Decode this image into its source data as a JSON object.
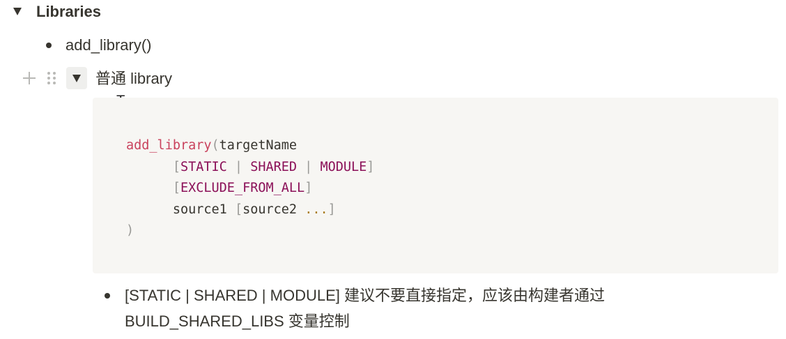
{
  "heading": {
    "title": "Libraries"
  },
  "bullets": [
    {
      "text": "add_library()"
    }
  ],
  "toggle_block": {
    "title": "普通 library",
    "code": {
      "fn": "add_library",
      "paren_open": "(",
      "arg": "targetName",
      "indent": "      ",
      "bracket_open": "[",
      "bracket_close": "]",
      "pipe": " | ",
      "kw_static": "STATIC",
      "kw_shared": "SHARED",
      "kw_module": "MODULE",
      "kw_exclude": "EXCLUDE_FROM_ALL",
      "source1": "source1 ",
      "source2": "source2 ",
      "ellipsis": "...",
      "paren_close": ")"
    }
  },
  "note": {
    "line1": "[STATIC | SHARED | MODULE] 建议不要直接指定，应该由构建者通过",
    "line2": "BUILD_SHARED_LIBS 变量控制"
  },
  "icons": [
    "toggle-arrow-icon",
    "plus-icon",
    "drag-handle-icon",
    "text-cursor-icon"
  ],
  "colors": {
    "text": "#37352f",
    "code_bg": "#f7f6f3",
    "code_function": "#c9425d",
    "code_keyword": "#8b1058",
    "code_punctuation": "#9a9a97",
    "code_operator": "#a87a1a",
    "handle_gray": "#b9b9b6"
  }
}
